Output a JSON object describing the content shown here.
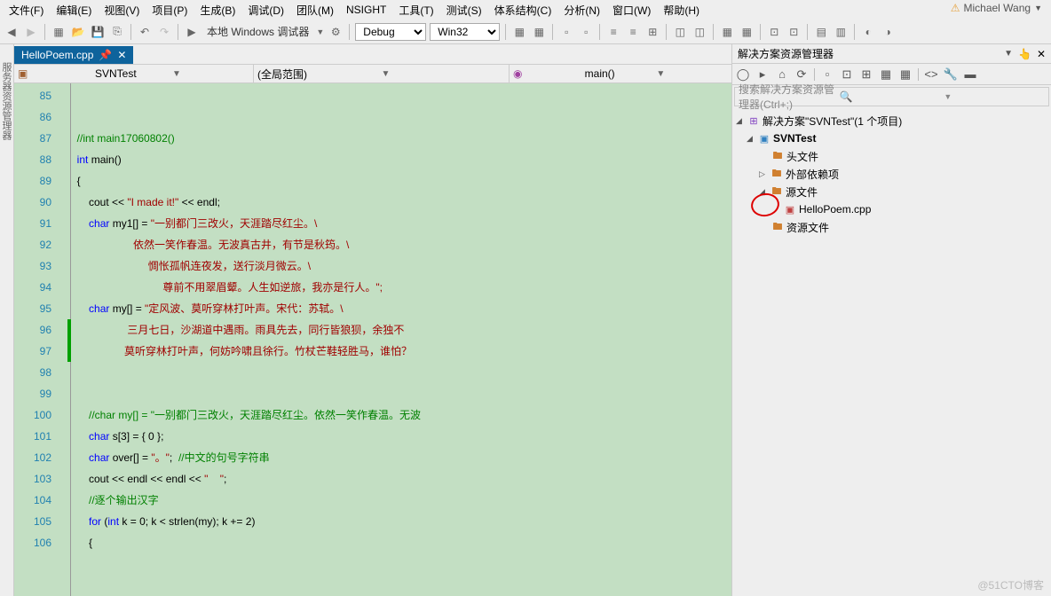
{
  "menu": [
    "文件(F)",
    "编辑(E)",
    "视图(V)",
    "项目(P)",
    "生成(B)",
    "调试(D)",
    "团队(M)",
    "NSIGHT",
    "工具(T)",
    "测试(S)",
    "体系结构(C)",
    "分析(N)",
    "窗口(W)",
    "帮助(H)"
  ],
  "user": "Michael Wang",
  "toolbar": {
    "run_label": "本地 Windows 调试器",
    "config": "Debug",
    "platform": "Win32"
  },
  "tab": {
    "filename": "HelloPoem.cpp"
  },
  "nav": {
    "scope": "SVNTest",
    "filter": "(全局范围)",
    "member": "main()"
  },
  "code": {
    "start": 85,
    "lines": [
      {
        "n": 85,
        "t": ""
      },
      {
        "n": 86,
        "t": ""
      },
      {
        "n": 87,
        "t": "  //int main17060802()",
        "cls": "c-cmt"
      },
      {
        "n": 88,
        "html": "  <span class='c-kw'>int</span> main()"
      },
      {
        "n": 89,
        "t": "  {"
      },
      {
        "n": 90,
        "html": "      cout &lt;&lt; <span class='c-str'>\"I made it!\"</span> &lt;&lt; endl;"
      },
      {
        "n": 91,
        "html": "      <span class='c-kw'>char</span> my1[] = <span class='c-str'>\"一别都门三改火，天涯踏尽红尘。\\</span>"
      },
      {
        "n": 92,
        "html": "                     <span class='c-str'>依然一笑作春温。无波真古井，有节是秋筠。\\</span>"
      },
      {
        "n": 93,
        "html": "                          <span class='c-str'>惆怅孤帆连夜发，送行淡月微云。\\</span>"
      },
      {
        "n": 94,
        "html": "                               <span class='c-str'>尊前不用翠眉颦。人生如逆旅，我亦是行人。\";</span>"
      },
      {
        "n": 95,
        "html": "      <span class='c-kw'>char</span> my[] = <span class='c-str'>\"定风波、莫听穿林打叶声。宋代：苏轼。\\</span>"
      },
      {
        "n": 96,
        "html": "                   <span class='c-str'>三月七日，沙湖道中遇雨。雨具先去，同行皆狼狈，余独不</span>"
      },
      {
        "n": 97,
        "html": "                  <span class='c-str'>莫听穿林打叶声，何妨吟啸且徐行。竹杖芒鞋轻胜马，谁怕？</span>"
      },
      {
        "n": 98,
        "t": ""
      },
      {
        "n": 99,
        "t": ""
      },
      {
        "n": 100,
        "html": "      <span class='c-cmt'>//char my[] = \"一别都门三改火，天涯踏尽红尘。依然一笑作春温。无波</span>"
      },
      {
        "n": 101,
        "html": "      <span class='c-kw'>char</span> s[3] = { 0 };"
      },
      {
        "n": 102,
        "html": "      <span class='c-kw'>char</span> over[] = <span class='c-str'>\"。\"</span>;  <span class='c-cmt'>//中文的句号字符串</span>"
      },
      {
        "n": 103,
        "html": "      cout &lt;&lt; endl &lt;&lt; endl &lt;&lt; <span class='c-str'>\"    \"</span>;"
      },
      {
        "n": 104,
        "html": "      <span class='c-cmt'>//逐个输出汉字</span>"
      },
      {
        "n": 105,
        "html": "      <span class='c-kw'>for</span> (<span class='c-kw'>int</span> k = 0; k &lt; strlen(my); k += 2)"
      },
      {
        "n": 106,
        "t": "      {"
      }
    ]
  },
  "solution_explorer": {
    "title": "解决方案资源管理器",
    "search_placeholder": "搜索解决方案资源管理器(Ctrl+;)",
    "root": "解决方案\"SVNTest\"(1 个项目)",
    "project": "SVNTest",
    "folders": {
      "headers": "头文件",
      "external": "外部依赖项",
      "source": "源文件",
      "resource": "资源文件"
    },
    "file": "HelloPoem.cpp"
  },
  "watermark": "@51CTO博客"
}
